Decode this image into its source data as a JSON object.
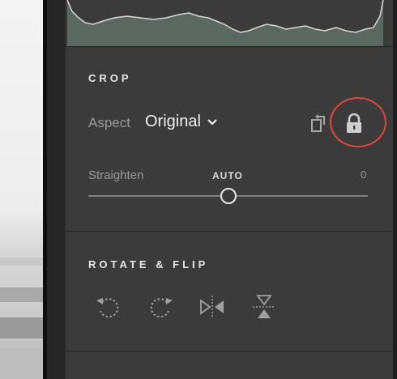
{
  "crop": {
    "title": "CROP",
    "aspect_label": "Aspect",
    "aspect_value": "Original",
    "straighten_label": "Straighten",
    "auto_label": "AUTO",
    "straighten_value": "0",
    "straighten_level": 0.5
  },
  "rotate_flip": {
    "title": "ROTATE & FLIP",
    "icons": [
      "rotate-left-icon",
      "rotate-right-icon",
      "flip-horizontal-icon",
      "flip-vertical-icon"
    ]
  },
  "colors": {
    "panel_bg": "#3b3b3b",
    "highlight_ring": "#e0463a",
    "text_primary": "#f2f2f2",
    "text_secondary": "#9a9a9a"
  }
}
